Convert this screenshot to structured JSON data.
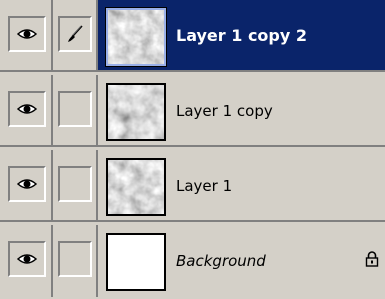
{
  "panel": {
    "layers": [
      {
        "name": "Layer 1 copy 2",
        "selected": true,
        "visible": true,
        "brush_active": true,
        "thumbnail": "clouds",
        "locked": false,
        "italic": false
      },
      {
        "name": "Layer 1 copy",
        "selected": false,
        "visible": true,
        "brush_active": false,
        "thumbnail": "clouds",
        "locked": false,
        "italic": false
      },
      {
        "name": "Layer 1",
        "selected": false,
        "visible": true,
        "brush_active": false,
        "thumbnail": "clouds",
        "locked": false,
        "italic": false
      },
      {
        "name": "Background",
        "selected": false,
        "visible": true,
        "brush_active": false,
        "thumbnail": "white",
        "locked": true,
        "italic": true
      }
    ],
    "icons": {
      "visibility": "eye-icon",
      "brush": "paintbrush-icon",
      "lock": "lock-icon"
    },
    "colors": {
      "panel_bg": "#d4d0c8",
      "selection": "#0a246a",
      "selected_text": "#ffffff",
      "text": "#000000"
    }
  }
}
